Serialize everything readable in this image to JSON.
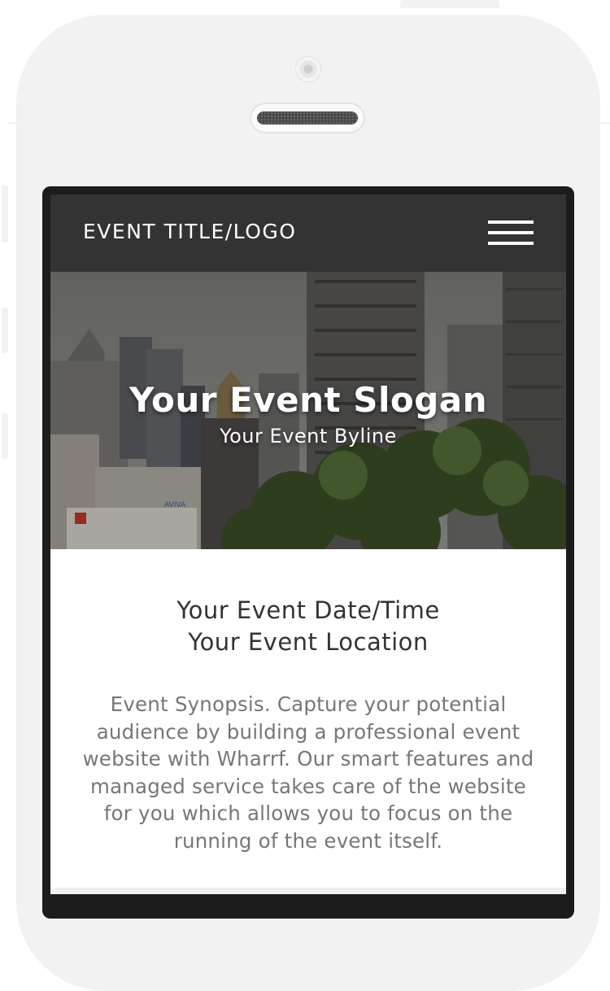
{
  "navbar": {
    "brand": "EVENT TITLE/LOGO",
    "menu_icon": "hamburger-menu-icon"
  },
  "hero": {
    "slogan": "Your Event Slogan",
    "byline": "Your Event Byline"
  },
  "info": {
    "date_time": "Your Event Date/Time",
    "location": "Your Event Location",
    "synopsis": "Event Synopsis. Capture your potential audience by building a professional event website with Wharrf. Our smart features and managed service takes care of the website for you which allows you to focus on the running of the event itself."
  },
  "colors": {
    "navbar_bg": "#333333",
    "phone_body": "#f2f2f2",
    "heading_text": "#333333",
    "body_text": "#777777"
  }
}
